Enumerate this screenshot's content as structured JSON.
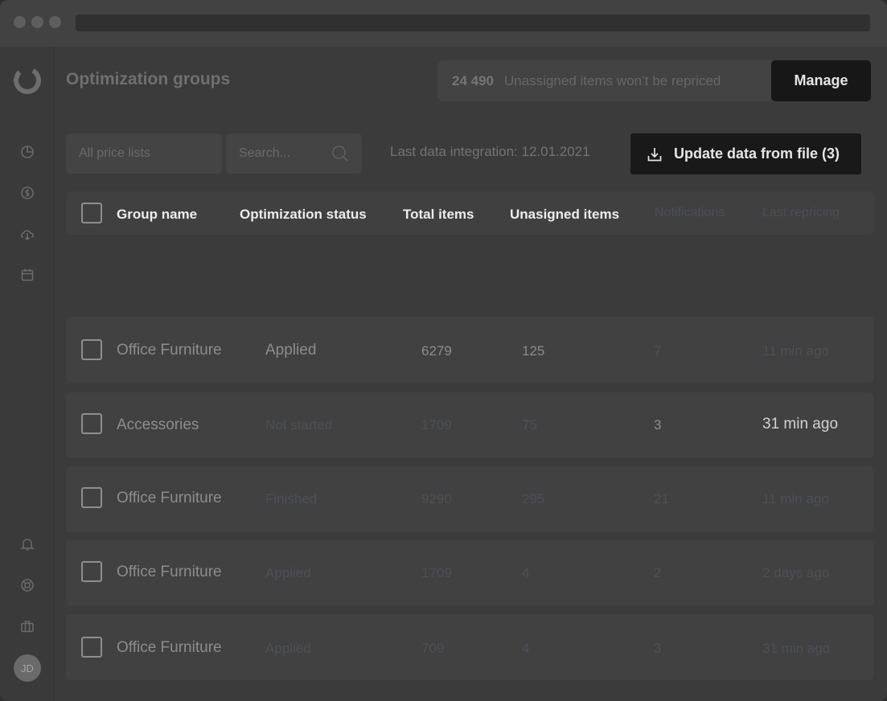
{
  "header": {
    "title": "Optimization groups",
    "unassigned_count": "24 490",
    "unassigned_text": "Unassigned items won’t be repriced",
    "manage_label": "Manage"
  },
  "filters": {
    "price_list": "All price lists",
    "search_placeholder": "Search...",
    "last_integration": "Last data integration: 12.01.2021",
    "update_label": "Update data from file (3)"
  },
  "table": {
    "columns": [
      "Group name",
      "Optimization status",
      "Total items",
      "Unasigned items",
      "Notifications",
      "Last repricing"
    ],
    "rows": [
      {
        "group": "Office Furniture",
        "status": "Applied",
        "total": "6279",
        "unassigned": "125",
        "notifications": "7",
        "last": "11 min ago"
      },
      {
        "group": "Accessories",
        "status": "Not started",
        "total": "1709",
        "unassigned": "75",
        "notifications": "3",
        "last": "31 min ago"
      },
      {
        "group": "Office Furniture",
        "status": "Finished",
        "total": "9290",
        "unassigned": "295",
        "notifications": "21",
        "last": "11 min ago"
      },
      {
        "group": "Office Furniture",
        "status": "Applied",
        "total": "1709",
        "unassigned": "4",
        "notifications": "2",
        "last": "2 days ago"
      },
      {
        "group": "Office Furniture",
        "status": "Applied",
        "total": "709",
        "unassigned": "4",
        "notifications": "3",
        "last": "31 min ago"
      }
    ]
  },
  "sidebar": {
    "icons": [
      "dashboard-icon",
      "pricing-icon",
      "cloud-download-icon",
      "calendar-icon",
      "bell-icon",
      "help-icon",
      "briefcase-icon"
    ],
    "avatar_initials": "JD"
  }
}
